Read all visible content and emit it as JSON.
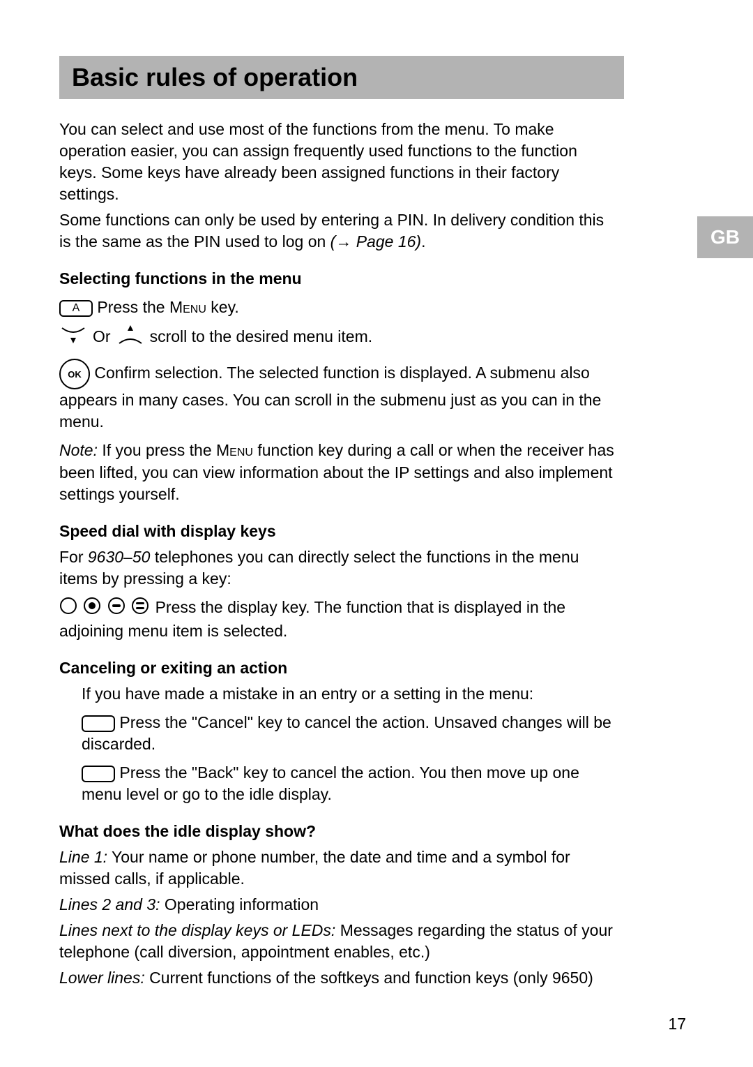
{
  "tab": "GB",
  "header": {
    "title": "Basic rules of operation"
  },
  "intro": {
    "p1": "You can select and use most of the functions from the menu. To make operation easier, you can assign frequently used functions to the function keys. Some keys have already been assigned functions in their factory settings.",
    "p2a": "Some functions can only be used by entering a PIN. In delivery condition this is the same as the PIN used to log on ",
    "p2b": "(→ Page 16)",
    "p2c": "."
  },
  "sec1": {
    "title": "Selecting functions in the menu",
    "menu_key_label": "A",
    "line1a": " Press the ",
    "line1b": "Menu",
    "line1c": " key.",
    "or": " Or ",
    "scroll": " scroll to the desired menu item.",
    "ok_label": "OK",
    "ok_text": " Confirm selection. The selected function is displayed. A submenu also appears in many cases. You can scroll in the submenu just as you can in the menu.",
    "note_label": "Note:",
    "note_text_a": " If you press the ",
    "note_text_b": "Menu",
    "note_text_c": " function key during a call or when the receiver has been lifted, you can view information about the IP settings and also implement settings yourself."
  },
  "sec2": {
    "title": "Speed dial with display keys",
    "p1a": "For ",
    "p1b": "9630–50",
    "p1c": " telephones you can directly select the functions in the menu items by pressing a key:",
    "p2": " Press the display key. The function that is displayed in the adjoining menu item is selected."
  },
  "sec3": {
    "title": "Canceling or exiting an action",
    "p1": "If you have made a mistake in an entry or a setting in the menu:",
    "cancel": " Press the \"Cancel\" key to cancel the action. Unsaved changes will be discarded.",
    "back": " Press the \"Back\" key to cancel the action. You then move up one menu level or go to the idle display."
  },
  "sec4": {
    "title": "What does the idle display show?",
    "l1a": "Line 1:",
    "l1b": " Your name or phone number, the date and time and a symbol for missed calls, if applicable.",
    "l2a": "Lines 2 and 3:",
    "l2b": " Operating information",
    "l3a": "Lines next to the display keys or LEDs:",
    "l3b": " Messages regarding the status of your telephone (call diversion, appointment enables, etc.)",
    "l4a": "Lower lines:",
    "l4b": " Current functions of the softkeys and function keys (only 9650)"
  },
  "page_number": "17"
}
